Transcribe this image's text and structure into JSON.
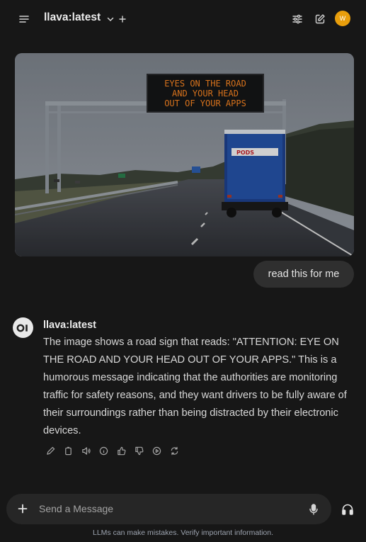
{
  "header": {
    "model": "llava:latest",
    "user_initial": "W",
    "icons": [
      "sidebar-toggle-icon",
      "chevron-down-icon",
      "plus-icon",
      "controls-sliders-icon",
      "new-chat-icon"
    ]
  },
  "image": {
    "sign_lines": [
      "EYES ON THE ROAD",
      "AND YOUR HEAD",
      "OUT OF YOUR APPS"
    ],
    "truck_logo": "PODS"
  },
  "user_message": "read this for me",
  "assistant": {
    "name": "llava:latest",
    "message": "The image shows a road sign that reads: \"ATTENTION: EYE ON THE ROAD AND YOUR HEAD OUT OF YOUR APPS.\" This is a humorous message indicating that the authorities are monitoring traffic for safety reasons, and they want drivers to be fully aware of their surroundings rather than being distracted by their electronic devices.",
    "actions": [
      "edit-icon",
      "copy-icon",
      "speaker-icon",
      "info-icon",
      "thumbs-up-icon",
      "thumbs-down-icon",
      "play-icon",
      "regenerate-icon"
    ]
  },
  "composer": {
    "placeholder": "Send a Message"
  },
  "disclaimer": "LLMs can make mistakes. Verify important information.",
  "colors": {
    "background": "#171717",
    "user_bubble": "#2f2f2f",
    "composer": "#262626",
    "avatar": "#e89e0c",
    "sign_text": "#f58220"
  }
}
